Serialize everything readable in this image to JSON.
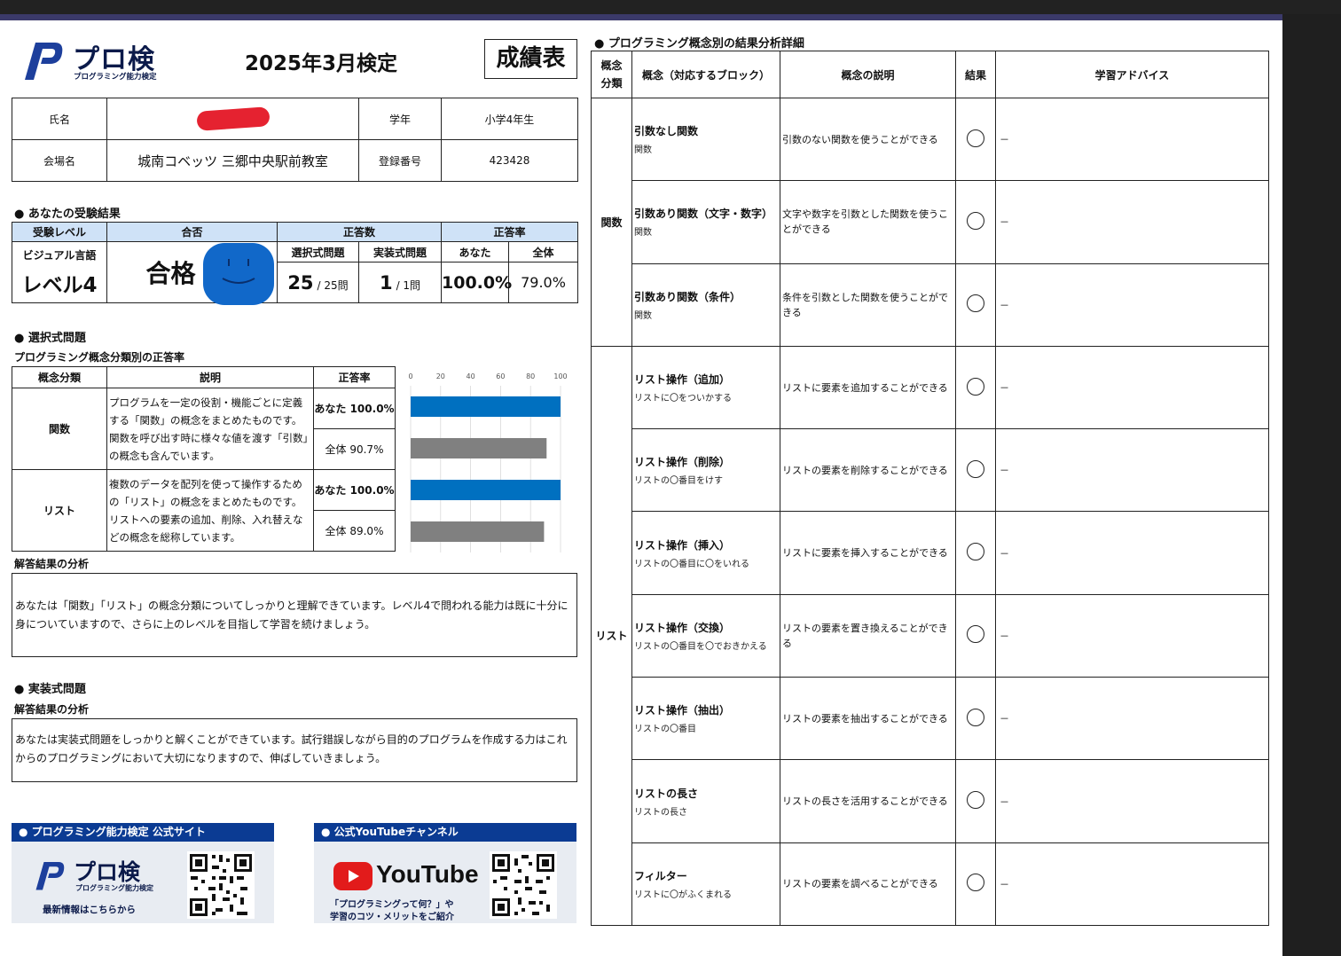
{
  "header": {
    "logo_name": "プロ検",
    "logo_sub": "プログラミング能力検定",
    "exam_title": "2025年3月検定",
    "report_label": "成績表"
  },
  "info": {
    "name_label": "氏名",
    "grade_label": "学年",
    "grade_value": "小学4年生",
    "venue_label": "会場名",
    "venue_value": "城南コベッツ 三郷中央駅前教室",
    "reg_label": "登録番号",
    "reg_value": "423428"
  },
  "result": {
    "section_title": "● あなたの受験結果",
    "level_header": "受験レベル",
    "pass_header": "合否",
    "correct_header": "正答数",
    "rate_header": "正答率",
    "level_small": "ビジュアル言語",
    "level_big": "レベル4",
    "pass_value": "合格",
    "choice_header": "選択式問題",
    "impl_header": "実装式問題",
    "you_header": "あなた",
    "all_header": "全体",
    "choice_score": "25",
    "choice_total": "/ 25問",
    "impl_score": "1",
    "impl_total": "/ 1問",
    "you_rate": "100.0%",
    "all_rate": "79.0%"
  },
  "choice": {
    "section_title": "● 選択式問題",
    "subtitle": "プログラミング概念分類別の正答率",
    "col_category": "概念分類",
    "col_desc": "説明",
    "col_rate": "正答率",
    "rows": [
      {
        "category": "関数",
        "desc": "プログラムを一定の役割・機能ごとに定義する「関数」の概念をまとめたものです。関数を呼び出す時に様々な値を渡す「引数」の概念も含んでいます。",
        "you": "あなた 100.0%",
        "all": "全体 90.7%"
      },
      {
        "category": "リスト",
        "desc": "複数のデータを配列を使って操作するための「リスト」の概念をまとめたものです。リストへの要素の追加、削除、入れ替えなどの概念を総称しています。",
        "you": "あなた 100.0%",
        "all": "全体 89.0%"
      }
    ],
    "analysis_label": "解答結果の分析",
    "analysis_text": "あなたは「関数」「リスト」の概念分類についてしっかりと理解できています。レベル4で問われる能力は既に十分に身についていますので、さらに上のレベルを目指して学習を続けましょう。"
  },
  "chart_data": {
    "type": "bar",
    "orientation": "horizontal",
    "categories": [
      "関数 あなた",
      "関数 全体",
      "リスト あなた",
      "リスト 全体"
    ],
    "values": [
      100.0,
      90.7,
      100.0,
      89.0
    ],
    "colors": [
      "#0070c0",
      "#808080",
      "#0070c0",
      "#808080"
    ],
    "xlim": [
      0,
      100
    ],
    "xticks": [
      "0",
      "20",
      "40",
      "60",
      "80",
      "100"
    ],
    "grid": true
  },
  "impl": {
    "section_title": "● 実装式問題",
    "analysis_label": "解答結果の分析",
    "analysis_text": "あなたは実装式問題をしっかりと解くことができています。試行錯誤しながら目的のプログラムを作成する力はこれからのプログラミングにおいて大切になりますので、伸ばしていきましょう。"
  },
  "promos": {
    "site_title": "● プログラミング能力検定 公式サイト",
    "site_logo": "プロ検",
    "site_logo_sub": "プログラミング能力検定",
    "site_caption": "最新情報はこちらから",
    "yt_title": "● 公式YouTubeチャンネル",
    "yt_brand": "YouTube",
    "yt_caption_1": "「プログラミングって何？」や",
    "yt_caption_2": "学習のコツ・メリットをご紹介"
  },
  "detail": {
    "section_title": "● プログラミング概念別の結果分析詳細",
    "col_group": "概念分類",
    "col_concept": "概念（対応するブロック）",
    "col_desc": "概念の説明",
    "col_result": "結果",
    "col_advice": "学習アドバイス",
    "group_function": "関数",
    "group_list": "リスト",
    "items": [
      {
        "name": "引数なし関数",
        "sub": "関数",
        "desc": "引数のない関数を使うことができる",
        "advice": "－"
      },
      {
        "name": "引数あり関数（文字・数字）",
        "sub": "関数",
        "desc": "文字や数字を引数とした関数を使うことができる",
        "advice": "－"
      },
      {
        "name": "引数あり関数（条件）",
        "sub": "関数",
        "desc": "条件を引数とした関数を使うことができる",
        "advice": "－"
      },
      {
        "name": "リスト操作（追加）",
        "sub": "リストに〇をついかする",
        "desc": "リストに要素を追加することができる",
        "advice": "－"
      },
      {
        "name": "リスト操作（削除）",
        "sub": "リストの〇番目をけす",
        "desc": "リストの要素を削除することができる",
        "advice": "－"
      },
      {
        "name": "リスト操作（挿入）",
        "sub": "リストの〇番目に〇をいれる",
        "desc": "リストに要素を挿入することができる",
        "advice": "－"
      },
      {
        "name": "リスト操作（交換）",
        "sub": "リストの〇番目を〇でおきかえる",
        "desc": "リストの要素を置き換えることができる",
        "advice": "－"
      },
      {
        "name": "リスト操作（抽出）",
        "sub": "リストの〇番目",
        "desc": "リストの要素を抽出することができる",
        "advice": "－"
      },
      {
        "name": "リストの長さ",
        "sub": "リストの長さ",
        "desc": "リストの長さを活用することができる",
        "advice": "－"
      },
      {
        "name": "フィルター",
        "sub": "リストに〇がふくまれる",
        "desc": "リストの要素を調べることができる",
        "advice": "－"
      }
    ]
  }
}
